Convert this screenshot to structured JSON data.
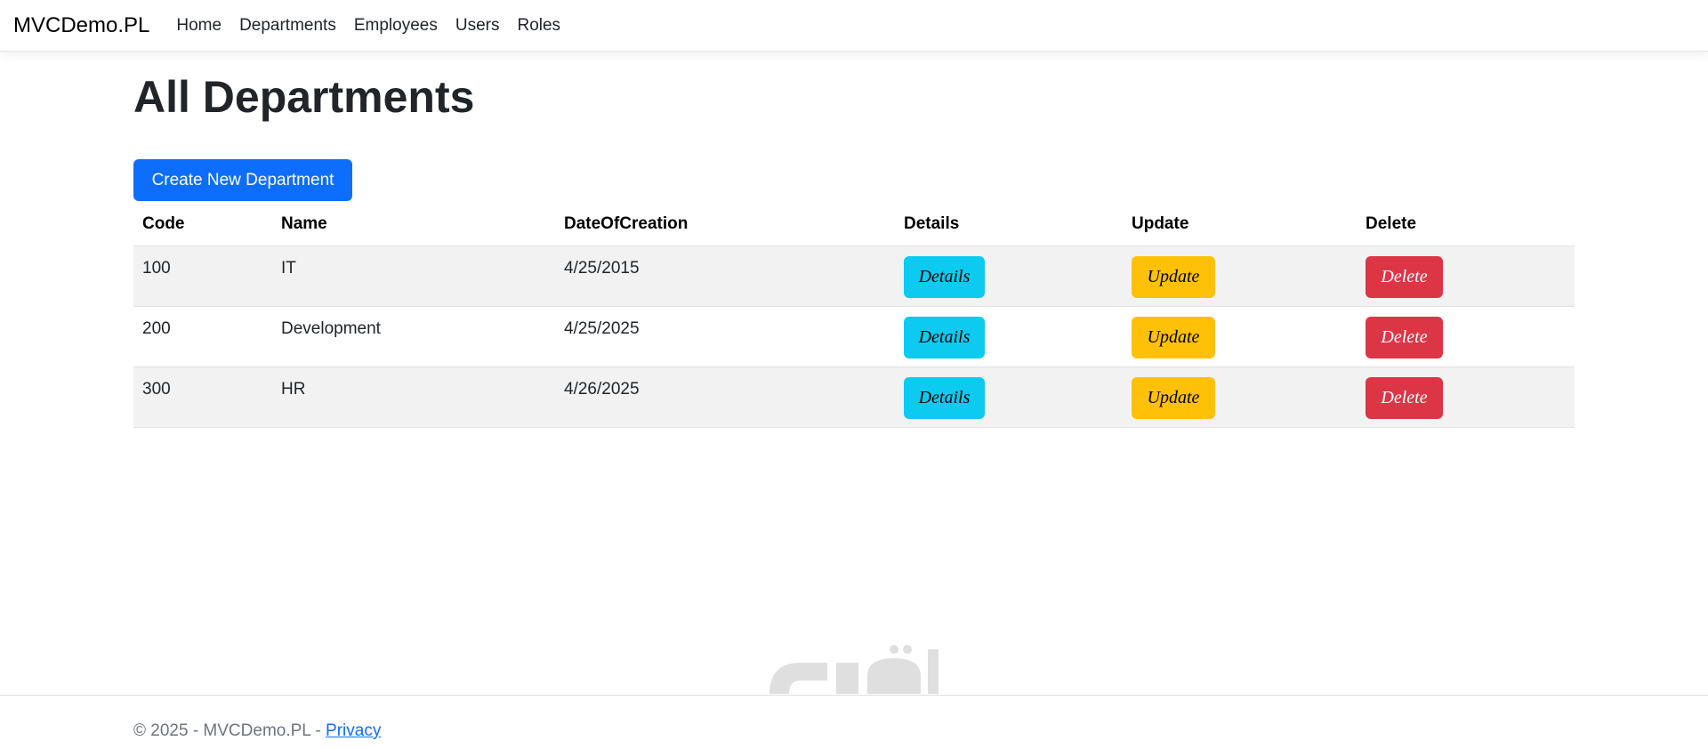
{
  "nav": {
    "brand": "MVCDemo.PL",
    "links": [
      "Home",
      "Departments",
      "Employees",
      "Users",
      "Roles"
    ]
  },
  "page": {
    "title": "All Departments",
    "create_button": "Create New Department"
  },
  "table": {
    "headers": [
      "Code",
      "Name",
      "DateOfCreation",
      "Details",
      "Update",
      "Delete"
    ],
    "rows": [
      {
        "code": "100",
        "name": "IT",
        "date": "4/25/2015",
        "details": "Details",
        "update": "Update",
        "delete": "Delete"
      },
      {
        "code": "200",
        "name": "Development",
        "date": "4/25/2025",
        "details": "Details",
        "update": "Update",
        "delete": "Delete"
      },
      {
        "code": "300",
        "name": "HR",
        "date": "4/26/2025",
        "details": "Details",
        "update": "Update",
        "delete": "Delete"
      }
    ]
  },
  "footer": {
    "text": "© 2025 - MVCDemo.PL - ",
    "link": "Privacy"
  },
  "watermark": {
    "text": "mostaql.com"
  },
  "colors": {
    "primary": "#0d6efd",
    "info": "#0dcaf0",
    "warning": "#ffc107",
    "danger": "#dc3545"
  }
}
